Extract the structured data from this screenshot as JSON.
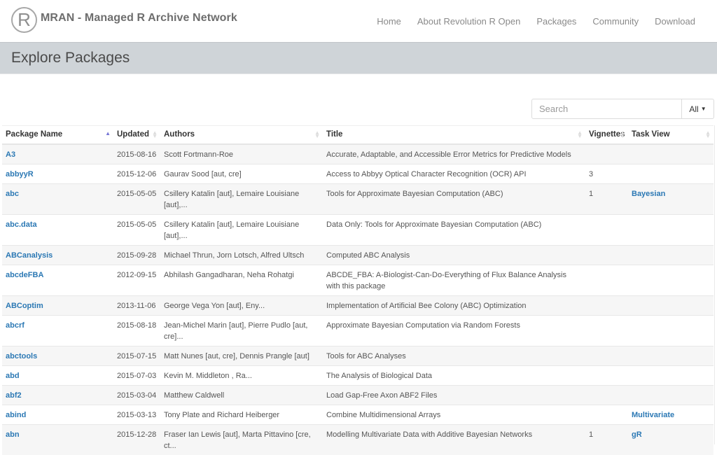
{
  "header": {
    "logo_letter": "R",
    "brand": "MRAN - Managed R Archive Network",
    "nav": [
      "Home",
      "About Revolution R Open",
      "Packages",
      "Community",
      "Download"
    ]
  },
  "banner": {
    "title": "Explore Packages"
  },
  "search": {
    "placeholder": "Search",
    "value": "",
    "filter_selected": "All"
  },
  "table": {
    "columns": [
      "Package Name",
      "Updated",
      "Authors",
      "Title",
      "Vignettes",
      "Task View"
    ],
    "sorted_column": "Package Name",
    "sort_direction": "ascending",
    "rows": [
      {
        "name": "A3",
        "updated": "2015-08-16",
        "authors": "Scott Fortmann-Roe",
        "title": "Accurate, Adaptable, and Accessible Error Metrics for Predictive Models",
        "vignettes": "",
        "task_view": ""
      },
      {
        "name": "abbyyR",
        "updated": "2015-12-06",
        "authors": "Gaurav Sood [aut, cre]",
        "title": "Access to Abbyy Optical Character Recognition (OCR) API",
        "vignettes": "3",
        "task_view": ""
      },
      {
        "name": "abc",
        "updated": "2015-05-05",
        "authors": "Csillery Katalin [aut], Lemaire Louisiane [aut],...",
        "title": "Tools for Approximate Bayesian Computation (ABC)",
        "vignettes": "1",
        "task_view": "Bayesian"
      },
      {
        "name": "abc.data",
        "updated": "2015-05-05",
        "authors": "Csillery Katalin [aut], Lemaire Louisiane [aut],...",
        "title": "Data Only: Tools for Approximate Bayesian Computation (ABC)",
        "vignettes": "",
        "task_view": ""
      },
      {
        "name": "ABCanalysis",
        "updated": "2015-09-28",
        "authors": "Michael Thrun, Jorn Lotsch, Alfred Ultsch",
        "title": "Computed ABC Analysis",
        "vignettes": "",
        "task_view": ""
      },
      {
        "name": "abcdeFBA",
        "updated": "2012-09-15",
        "authors": "Abhilash Gangadharan, Neha Rohatgi",
        "title": "ABCDE_FBA: A-Biologist-Can-Do-Everything of Flux Balance Analysis with this package",
        "vignettes": "",
        "task_view": ""
      },
      {
        "name": "ABCoptim",
        "updated": "2013-11-06",
        "authors": "George Vega Yon [aut], Eny...",
        "title": "Implementation of Artificial Bee Colony (ABC) Optimization",
        "vignettes": "",
        "task_view": ""
      },
      {
        "name": "abcrf",
        "updated": "2015-08-18",
        "authors": "Jean-Michel Marin [aut], Pierre Pudlo [aut, cre]...",
        "title": "Approximate Bayesian Computation via Random Forests",
        "vignettes": "",
        "task_view": ""
      },
      {
        "name": "abctools",
        "updated": "2015-07-15",
        "authors": "Matt Nunes [aut, cre], Dennis Prangle [aut]",
        "title": "Tools for ABC Analyses",
        "vignettes": "",
        "task_view": ""
      },
      {
        "name": "abd",
        "updated": "2015-07-03",
        "authors": "Kevin M. Middleton , Ra...",
        "title": "The Analysis of Biological Data",
        "vignettes": "",
        "task_view": ""
      },
      {
        "name": "abf2",
        "updated": "2015-03-04",
        "authors": "Matthew Caldwell",
        "title": "Load Gap-Free Axon ABF2 Files",
        "vignettes": "",
        "task_view": ""
      },
      {
        "name": "abind",
        "updated": "2015-03-13",
        "authors": "Tony Plate and Richard Heiberger",
        "title": "Combine Multidimensional Arrays",
        "vignettes": "",
        "task_view": "Multivariate"
      },
      {
        "name": "abn",
        "updated": "2015-12-28",
        "authors": "Fraser Ian Lewis [aut], Marta Pittavino [cre, ct...",
        "title": "Modelling Multivariate Data with Additive Bayesian Networks",
        "vignettes": "1",
        "task_view": "gR"
      }
    ]
  }
}
